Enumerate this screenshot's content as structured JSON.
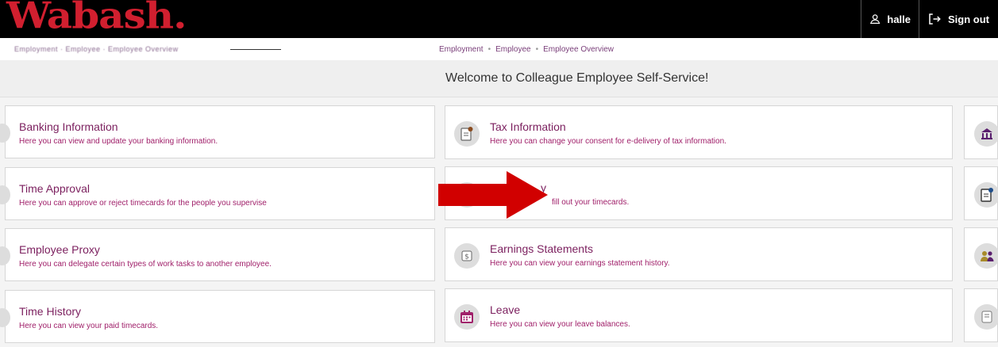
{
  "header": {
    "logo_text": "Wabash",
    "logo_dot": ".",
    "user_label": "halle",
    "signout_label": "Sign out"
  },
  "breadcrumb": {
    "faded_text": "Employment   ·   Employee   ·   Employee Overview",
    "items": [
      "Employment",
      "Employee",
      "Employee Overview"
    ],
    "separator": "•"
  },
  "welcome": "Welcome to Colleague Employee Self-Service!",
  "left_cards": [
    {
      "title": "Banking Information",
      "desc": "Here you can view and update your banking information."
    },
    {
      "title": "Time Approval",
      "desc": "Here you can approve or reject timecards for the people you supervise"
    },
    {
      "title": "Employee Proxy",
      "desc": "Here you can delegate certain types of work tasks to another employee."
    },
    {
      "title": "Time History",
      "desc": "Here you can view your paid timecards."
    }
  ],
  "mid_cards": [
    {
      "title": "Tax Information",
      "desc": "Here you can change your consent for e-delivery of tax information.",
      "icon": "tax-document-icon"
    },
    {
      "title": "y",
      "desc": "fill out your timecards.",
      "icon": "timecard-icon"
    },
    {
      "title": "Earnings Statements",
      "desc": "Here you can view your earnings statement history.",
      "icon": "earnings-icon"
    },
    {
      "title": "Leave",
      "desc": "Here you can view your leave balances.",
      "icon": "calendar-icon"
    }
  ],
  "right_icons": [
    "bank-icon",
    "document-gear-icon",
    "people-icon",
    "receipt-icon"
  ],
  "colors": {
    "brand_red": "#d11f2f",
    "title_purple": "#7b1f5e",
    "desc_magenta": "#a0206a",
    "arrow_red": "#d10000"
  }
}
